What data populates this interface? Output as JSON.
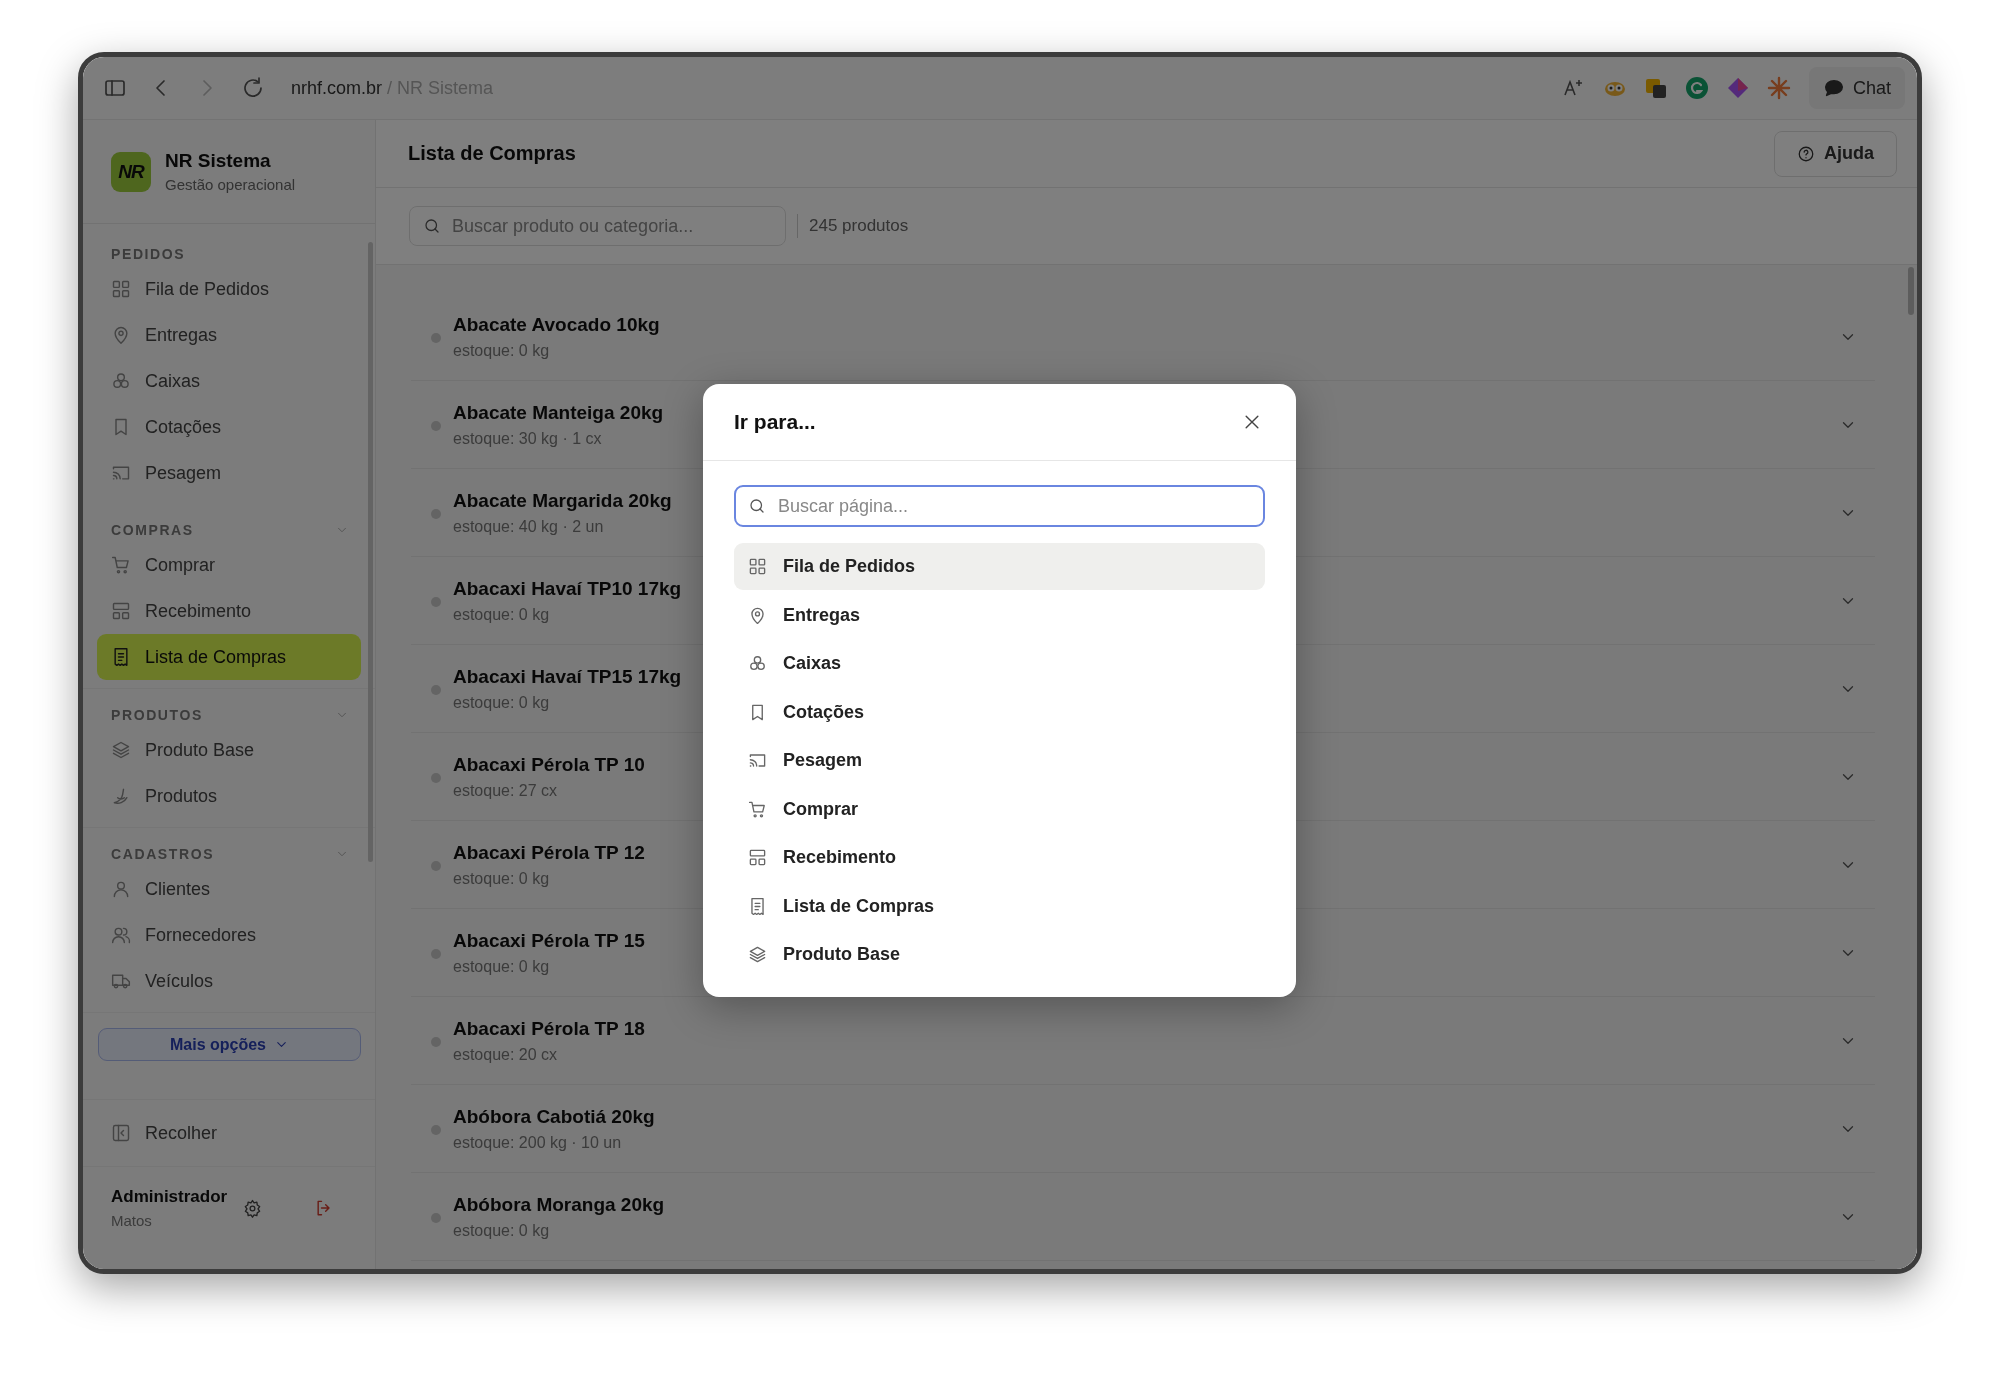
{
  "browser": {
    "url_host": "nrhf.com.br",
    "url_path": "/ NR Sistema",
    "chat_button": "Chat"
  },
  "sidebar": {
    "brand": {
      "logo": "NR",
      "name": "NR Sistema",
      "subtitle": "Gestão operacional"
    },
    "sections": [
      {
        "title": "PEDIDOS",
        "collapsible": false,
        "items": [
          {
            "label": "Fila de Pedidos",
            "selected": false
          },
          {
            "label": "Entregas",
            "selected": false
          },
          {
            "label": "Caixas",
            "selected": false
          },
          {
            "label": "Cotações",
            "selected": false
          },
          {
            "label": "Pesagem",
            "selected": false
          }
        ]
      },
      {
        "title": "COMPRAS",
        "collapsible": true,
        "items": [
          {
            "label": "Comprar",
            "selected": false
          },
          {
            "label": "Recebimento",
            "selected": false
          },
          {
            "label": "Lista de Compras",
            "selected": true
          }
        ]
      },
      {
        "title": "PRODUTOS",
        "collapsible": true,
        "items": [
          {
            "label": "Produto Base",
            "selected": false
          },
          {
            "label": "Produtos",
            "selected": false
          }
        ]
      },
      {
        "title": "CADASTROS",
        "collapsible": true,
        "items": [
          {
            "label": "Clientes",
            "selected": false
          },
          {
            "label": "Fornecedores",
            "selected": false
          },
          {
            "label": "Veículos",
            "selected": false
          }
        ]
      }
    ],
    "more_button": "Mais opções",
    "collapse_button": "Recolher",
    "user": {
      "name": "Administrador",
      "detail": "Matos"
    }
  },
  "main": {
    "title": "Lista de Compras",
    "help_button": "Ajuda",
    "search": {
      "placeholder": "Buscar produto ou categoria..."
    },
    "count": "245 produtos",
    "products": [
      {
        "name": "Abacate Avocado 10kg",
        "stock": "estoque: 0 kg"
      },
      {
        "name": "Abacate Manteiga 20kg",
        "stock": "estoque: 30 kg · 1 cx"
      },
      {
        "name": "Abacate Margarida 20kg",
        "stock": "estoque: 40 kg · 2 un"
      },
      {
        "name": "Abacaxi Havaí TP10 17kg",
        "stock": "estoque: 0 kg"
      },
      {
        "name": "Abacaxi Havaí TP15 17kg",
        "stock": "estoque: 0 kg"
      },
      {
        "name": "Abacaxi Pérola TP 10",
        "stock": "estoque: 27 cx"
      },
      {
        "name": "Abacaxi Pérola TP 12",
        "stock": "estoque: 0 kg"
      },
      {
        "name": "Abacaxi Pérola TP 15",
        "stock": "estoque: 0 kg"
      },
      {
        "name": "Abacaxi Pérola TP 18",
        "stock": "estoque: 20 cx"
      },
      {
        "name": "Abóbora Cabotiá 20kg",
        "stock": "estoque: 200 kg · 10 un"
      },
      {
        "name": "Abóbora Moranga 20kg",
        "stock": "estoque: 0 kg"
      }
    ]
  },
  "dialog": {
    "title": "Ir para...",
    "search": {
      "placeholder": "Buscar página..."
    },
    "items": [
      {
        "label": "Fila de Pedidos",
        "selected": true
      },
      {
        "label": "Entregas",
        "selected": false
      },
      {
        "label": "Caixas",
        "selected": false
      },
      {
        "label": "Cotações",
        "selected": false
      },
      {
        "label": "Pesagem",
        "selected": false
      },
      {
        "label": "Comprar",
        "selected": false
      },
      {
        "label": "Recebimento",
        "selected": false
      },
      {
        "label": "Lista de Compras",
        "selected": false
      },
      {
        "label": "Produto Base",
        "selected": false
      }
    ]
  }
}
